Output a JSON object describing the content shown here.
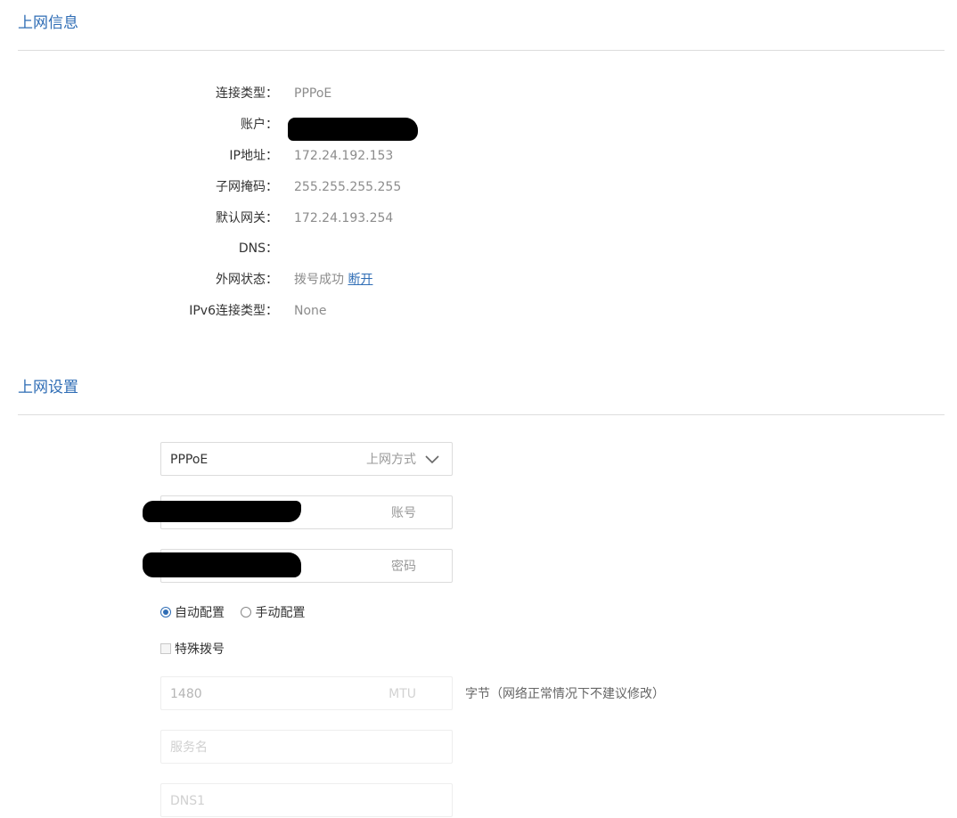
{
  "info_section": {
    "title": "上网信息",
    "rows": [
      {
        "label": "连接类型：",
        "value": "PPPoE"
      },
      {
        "label": "账户：",
        "value": ""
      },
      {
        "label": "IP地址：",
        "value": "172.24.192.153"
      },
      {
        "label": "子网掩码：",
        "value": "255.255.255.255"
      },
      {
        "label": "默认网关：",
        "value": "172.24.193.254"
      },
      {
        "label": "DNS：",
        "value": ""
      },
      {
        "label": "外网状态：",
        "value": "拨号成功",
        "link": "断开"
      },
      {
        "label": "IPv6连接类型：",
        "value": "None"
      }
    ]
  },
  "settings_section": {
    "title": "上网设置",
    "mode_select": {
      "value": "PPPoE",
      "suffix": "上网方式"
    },
    "account_field": {
      "value": "",
      "suffix": "账号"
    },
    "password_field": {
      "value": "",
      "suffix": "密码"
    },
    "config_options": [
      {
        "label": "自动配置",
        "checked": true
      },
      {
        "label": "手动配置",
        "checked": false
      }
    ],
    "special_dial": {
      "label": "特殊拨号",
      "checked": false
    },
    "mtu_field": {
      "value": "1480",
      "suffix": "MTU",
      "hint": "字节（网络正常情况下不建议修改）"
    },
    "service_field": {
      "placeholder": "服务名"
    },
    "dns1_field": {
      "placeholder": "DNS1"
    }
  },
  "colors": {
    "accent": "#2f6db5",
    "label": "#333333",
    "value": "#8c8c8c",
    "border": "#dcdcdc"
  }
}
